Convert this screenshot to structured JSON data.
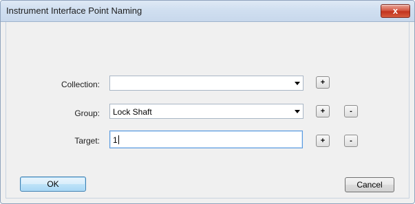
{
  "window": {
    "title": "Instrument Interface Point Naming",
    "close_glyph": "x"
  },
  "form": {
    "collection": {
      "label": "Collection:",
      "value": "",
      "add_label": "+"
    },
    "group": {
      "label": "Group:",
      "value": "Lock Shaft",
      "add_label": "+",
      "remove_label": "-"
    },
    "target": {
      "label": "Target:",
      "value": "1",
      "add_label": "+",
      "remove_label": "-"
    }
  },
  "buttons": {
    "ok_label": "OK",
    "cancel_label": "Cancel"
  }
}
